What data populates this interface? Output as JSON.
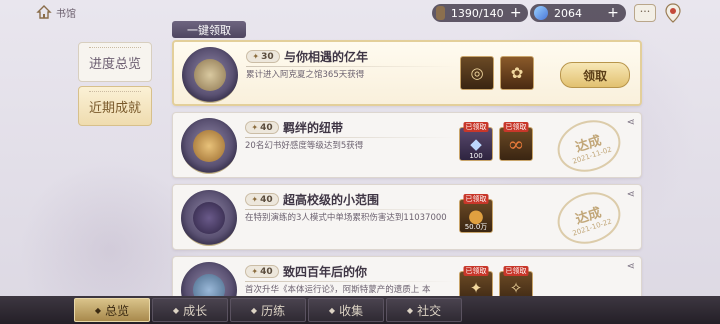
{
  "topbar": {
    "home_label": "书馆",
    "stamina": "1390/140",
    "gems": "2064",
    "plus": "+",
    "chat_glyph": "···"
  },
  "claim_all_label": "一键领取",
  "side_tabs": [
    {
      "label": "进度总览"
    },
    {
      "label": "近期成就"
    }
  ],
  "cards": [
    {
      "points": "30",
      "title": "与你相遇的亿年",
      "desc": "累计进入阿克夏之馆365天获得",
      "rewards": [
        {
          "icon": "clock-icon",
          "glyph": "◎",
          "tag": "",
          "qty": ""
        },
        {
          "icon": "portrait-icon",
          "glyph": "✿",
          "tag": "",
          "qty": ""
        }
      ],
      "action": "领取"
    },
    {
      "points": "40",
      "title": "羁绊的纽带",
      "desc": "20名幻书好感度等级达到5获得",
      "rewards": [
        {
          "icon": "crystal-icon",
          "glyph": "◆",
          "tag": "已领取",
          "qty": "100"
        },
        {
          "icon": "infinity-icon",
          "glyph": "∞",
          "tag": "已领取",
          "qty": ""
        }
      ],
      "stamp": {
        "text": "达成",
        "date": "2021-11-02"
      }
    },
    {
      "points": "40",
      "title": "超高校级的小范围",
      "desc": "在特别演练的3人模式中单场累积伤害达到11037000",
      "rewards": [
        {
          "icon": "orb-icon",
          "glyph": "●",
          "tag": "已领取",
          "qty": "50.0万"
        }
      ],
      "stamp": {
        "text": "达成",
        "date": "2021-10-22"
      }
    },
    {
      "points": "40",
      "title": "致四百年后的你",
      "desc": "首次升华《本体运行论》，阿斯特蒙产的遗质上 本",
      "rewards": [
        {
          "icon": "pendant-icon",
          "glyph": "✦",
          "tag": "已领取",
          "qty": ""
        },
        {
          "icon": "pendant-icon",
          "glyph": "✧",
          "tag": "已领取",
          "qty": ""
        }
      ]
    }
  ],
  "bottom_nav": [
    {
      "label": "总览"
    },
    {
      "label": "成长"
    },
    {
      "label": "历练"
    },
    {
      "label": "收集"
    },
    {
      "label": "社交"
    }
  ]
}
